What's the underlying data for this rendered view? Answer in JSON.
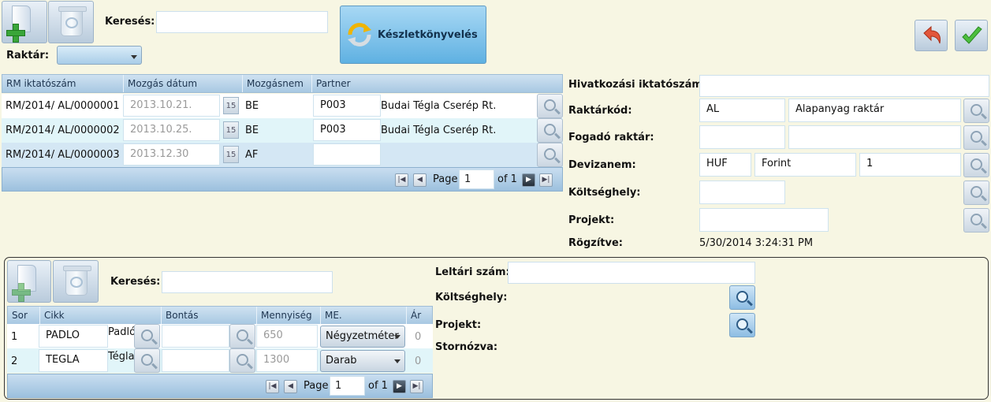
{
  "top": {
    "search_label": "Keresés:",
    "warehouse_label": "Raktár:",
    "booking_button": "Készletkönyvelés"
  },
  "grid1": {
    "columns": [
      "RM iktatószám",
      "Mozgás dátum",
      "Mozgásnem",
      "Partner"
    ],
    "rows": [
      {
        "id": "RM/2014/  AL/0000001",
        "date": "2013.10.21.",
        "cal": "15",
        "type": "BE",
        "partner_code": "P003",
        "partner_name": "Budai Tégla Cserép Rt."
      },
      {
        "id": "RM/2014/  AL/0000002",
        "date": "2013.10.25.",
        "cal": "15",
        "type": "BE",
        "partner_code": "P003",
        "partner_name": "Budai Tégla Cserép Rt."
      },
      {
        "id": "RM/2014/  AL/0000003",
        "date": "2013.12.30",
        "cal": "15",
        "type": "AF",
        "partner_code": "",
        "partner_name": ""
      }
    ],
    "pager": {
      "page_label": "Page",
      "page_value": "1",
      "of_label": "of 1"
    }
  },
  "form1": {
    "ref_label": "Hivatkozási iktatószám:",
    "warehouse_code_label": "Raktárkód:",
    "warehouse_code": "AL",
    "warehouse_name": "Alapanyag raktár",
    "receiving_label": "Fogadó raktár:",
    "currency_label": "Devizanem:",
    "currency_code": "HUF",
    "currency_name": "Forint",
    "currency_rate": "1",
    "cost_center_label": "Költséghely:",
    "project_label": "Projekt:",
    "recorded_label": "Rögzítve:",
    "recorded_value": "5/30/2014 3:24:31 PM"
  },
  "bottom": {
    "search_label": "Keresés:",
    "inventory_label": "Leltári szám:",
    "cost_center_label": "Költséghely:",
    "project_label": "Projekt:",
    "storno_label": "Stornózva:"
  },
  "grid2": {
    "columns": [
      "Sor",
      "Cikk",
      "Bontás",
      "Mennyiség",
      "ME.",
      "Ár"
    ],
    "rows": [
      {
        "row": "1",
        "code": "PADLO",
        "name": "Padló",
        "qty": "650",
        "unit": "Négyzetméter",
        "price": "0"
      },
      {
        "row": "2",
        "code": "TEGLA",
        "name": "Tégla",
        "qty": "1300",
        "unit": "Darab",
        "price": "0"
      }
    ],
    "pager": {
      "page_label": "Page",
      "page_value": "1",
      "of_label": "of 1"
    }
  },
  "colors": {
    "background": "#f7f6e3",
    "header": "#a8c8e2",
    "accent": "#3aa63a"
  }
}
